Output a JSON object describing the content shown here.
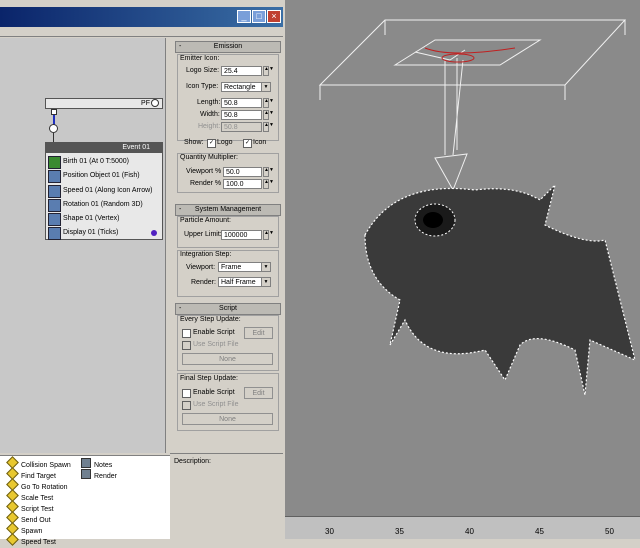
{
  "window": {
    "controls": [
      "minimize",
      "maximize",
      "close"
    ]
  },
  "flow": {
    "root_label": "PF",
    "event": {
      "title": "Event 01",
      "operators": [
        {
          "label": "Birth 01 (At 0 T:5000)",
          "icon": "birth-icon"
        },
        {
          "label": "Position Object 01 (Fish)",
          "icon": "position-icon"
        },
        {
          "label": "Speed 01 (Along Icon Arrow)",
          "icon": "speed-icon"
        },
        {
          "label": "Rotation 01 (Random 3D)",
          "icon": "rotation-icon"
        },
        {
          "label": "Shape 01 (Vertex)",
          "icon": "shape-icon"
        },
        {
          "label": "Display 01 (Ticks)",
          "icon": "display-icon"
        }
      ]
    }
  },
  "depot": {
    "left": [
      "Collision Spawn",
      "Find Target",
      "Go To Rotation",
      "Scale Test",
      "Script Test",
      "Send Out",
      "Spawn",
      "Speed Test"
    ],
    "right": [
      "Notes",
      "Render"
    ]
  },
  "emission": {
    "header": "Emission",
    "emitter_icon_label": "Emitter Icon:",
    "logo_size_label": "Logo Size:",
    "logo_size": "25.4",
    "icon_type_label": "Icon Type:",
    "icon_type": "Rectangle",
    "length_label": "Length:",
    "length": "50.8",
    "width_label": "Width:",
    "width": "50.8",
    "height_label": "Height:",
    "height": "50.8",
    "show_label": "Show:",
    "logo_label": "Logo",
    "logo_checked": true,
    "icon_label": "Icon",
    "icon_checked": true,
    "quantity_label": "Quantity Multiplier:",
    "viewport_label": "Viewport %",
    "viewport": "50.0",
    "render_label": "Render %",
    "render": "100.0"
  },
  "system": {
    "header": "System Management",
    "particle_amount_label": "Particle Amount:",
    "upper_limit_label": "Upper Limit:",
    "upper_limit": "100000",
    "integration_label": "Integration Step:",
    "viewport_label": "Viewport:",
    "viewport": "Frame",
    "render_label": "Render:",
    "render": "Half Frame"
  },
  "script": {
    "header": "Script",
    "every_step_label": "Every Step Update:",
    "enable_script_label": "Enable Script",
    "edit_label": "Edit",
    "use_script_file_label": "Use Script File",
    "none_label": "None",
    "final_step_label": "Final Step Update:",
    "enable_script_label_2": "Enable Script",
    "edit_label_2": "Edit",
    "use_script_file_label_2": "Use Script File",
    "none_label_2": "None"
  },
  "description_label": "Description:",
  "timeline": {
    "ticks": [
      "30",
      "35",
      "40",
      "45",
      "50"
    ]
  },
  "colors": {
    "titlebar": "#0a246a",
    "viewport_bg": "#8a8a8a",
    "panel_bg": "#d4d0c8"
  }
}
